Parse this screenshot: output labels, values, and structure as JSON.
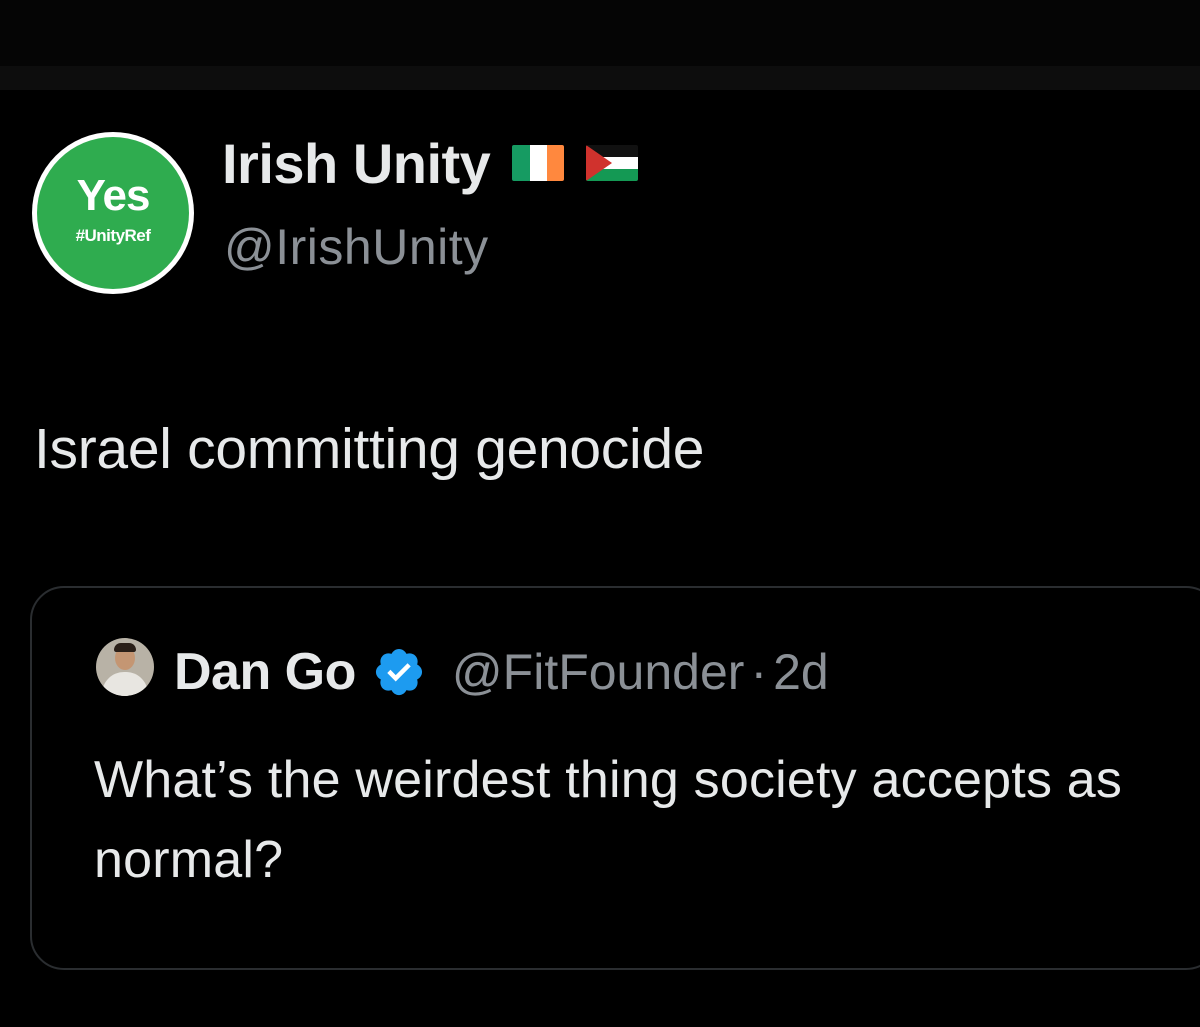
{
  "author": {
    "display_name": "Irish Unity",
    "handle": "@IrishUnity",
    "avatar": {
      "main_text": "Yes",
      "sub_text": "#UnityRef",
      "bg_color": "#2fac4f"
    },
    "flags": [
      "ireland-flag-icon",
      "palestine-flag-icon"
    ]
  },
  "tweet": {
    "text": "Israel committing genocide"
  },
  "quoted_tweet": {
    "display_name": "Dan Go",
    "verified": true,
    "verified_color": "#1d9bf0",
    "handle": "@FitFounder",
    "separator": "·",
    "time": "2d",
    "text": "What’s the weirdest thing society accepts as normal?"
  },
  "colors": {
    "background": "#000000",
    "primary_text": "#e7e9ea",
    "secondary_text": "#8b9096",
    "card_border": "#2a2d30"
  }
}
